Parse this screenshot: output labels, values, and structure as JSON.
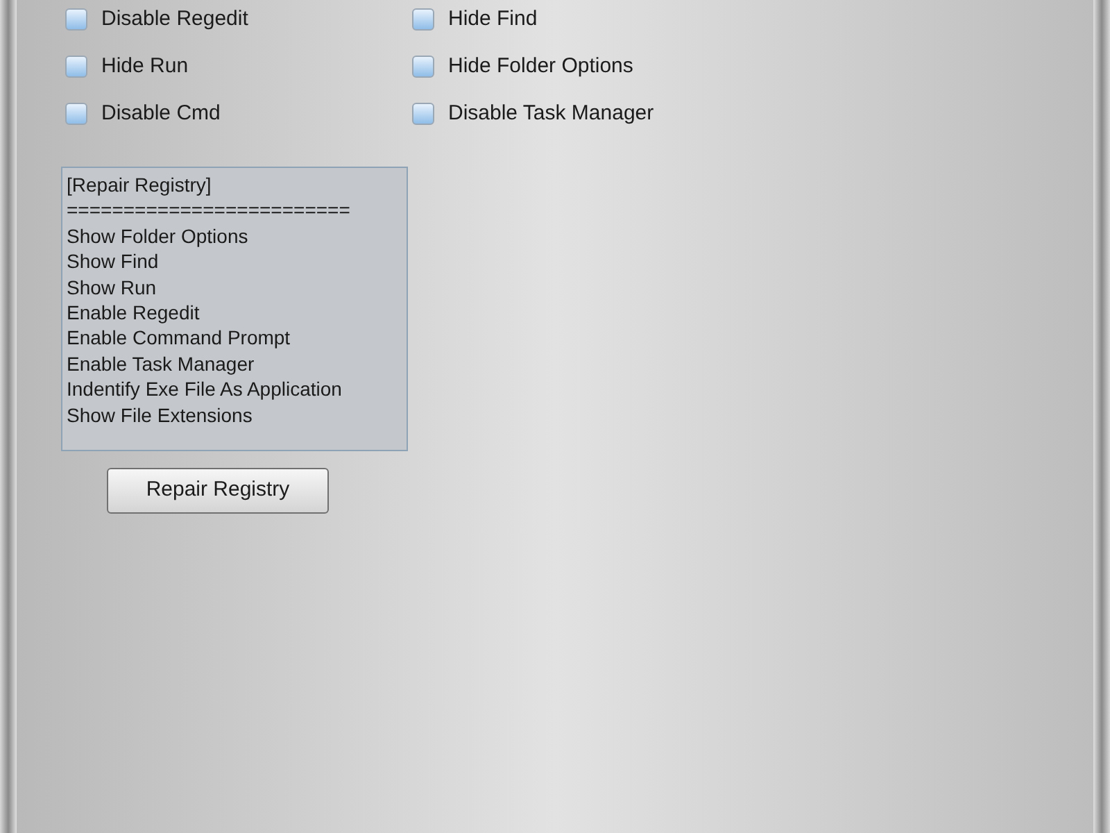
{
  "options": [
    {
      "label": "Disable Regedit",
      "checked": false
    },
    {
      "label": "Hide Find",
      "checked": false
    },
    {
      "label": "Hide Run",
      "checked": false
    },
    {
      "label": "Hide Folder Options",
      "checked": false
    },
    {
      "label": "Disable Cmd",
      "checked": false
    },
    {
      "label": "Disable Task Manager",
      "checked": false
    }
  ],
  "repair_list": {
    "lines": [
      "[Repair Registry]",
      "=========================",
      "Show Folder Options",
      "Show Find",
      "Show Run",
      "Enable Regedit",
      "Enable Command Prompt",
      "Enable Task Manager",
      "Indentify Exe File As Application",
      "Show File Extensions"
    ]
  },
  "repair_button": {
    "label": "Repair Registry"
  }
}
